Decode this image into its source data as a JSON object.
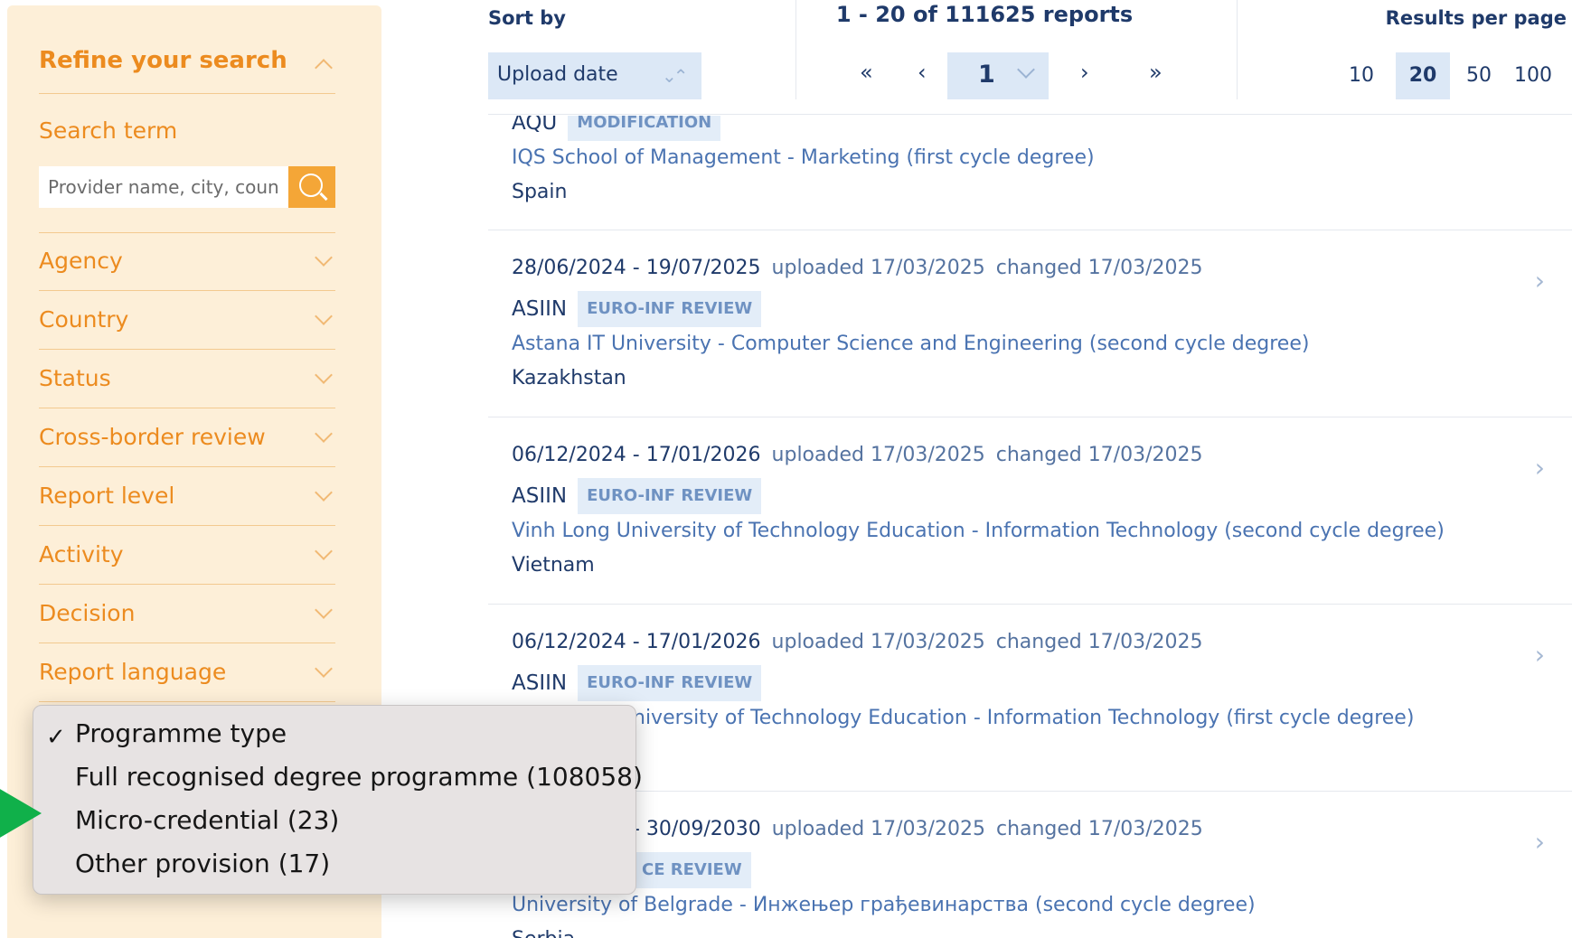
{
  "sidebar": {
    "title": "Refine your search",
    "search_label": "Search term",
    "search_placeholder": "Provider name, city, coun",
    "filters": [
      "Agency",
      "Country",
      "Status",
      "Cross-border review",
      "Report level",
      "Activity",
      "Decision",
      "Report language"
    ]
  },
  "toolbar": {
    "sort_label": "Sort by",
    "sort_value": "Upload date",
    "count_text": "1 - 20 of 111625 reports",
    "first": "«",
    "prev": "‹",
    "page": "1",
    "next": "›",
    "last": "»",
    "rpp_label": "Results per page",
    "rpp_options": [
      "10",
      "20",
      "50",
      "100"
    ],
    "rpp_selected": "20"
  },
  "results": [
    {
      "dates": "",
      "uploaded": "",
      "changed": "",
      "agency": "AQU",
      "badge": "MODIFICATION",
      "programme": "IQS School of Management - Marketing (first cycle degree)",
      "country": "Spain"
    },
    {
      "dates": "28/06/2024 - 19/07/2025",
      "uploaded": "uploaded 17/03/2025",
      "changed": "changed 17/03/2025",
      "agency": "ASIIN",
      "badge": "EURO-INF REVIEW",
      "programme": "Astana IT University - Computer Science and Engineering (second cycle degree)",
      "country": "Kazakhstan"
    },
    {
      "dates": "06/12/2024 - 17/01/2026",
      "uploaded": "uploaded 17/03/2025",
      "changed": "changed 17/03/2025",
      "agency": "ASIIN",
      "badge": "EURO-INF REVIEW",
      "programme": "Vinh Long University of Technology Education - Information Technology (second cycle degree)",
      "country": "Vietnam"
    },
    {
      "dates": "06/12/2024 - 17/01/2026",
      "uploaded": "uploaded 17/03/2025",
      "changed": "changed 17/03/2025",
      "agency": "ASIIN",
      "badge": "EURO-INF REVIEW",
      "programme": "niversity of Technology Education - Information Technology (first cycle degree)",
      "country": ""
    },
    {
      "dates": "- 30/09/2030",
      "uploaded": "uploaded 17/03/2025",
      "changed": "changed 17/03/2025",
      "agency": "",
      "badge": "CE REVIEW",
      "programme": "University of Belgrade - Инжењер грађевинарства (second cycle degree)",
      "country": "Serbia"
    }
  ],
  "popup": {
    "check": "✓",
    "options": [
      "Programme type",
      "Full recognised degree programme (108058)",
      "Micro-credential (23)",
      "Other provision (17)"
    ]
  },
  "colors": {
    "sidebar_bg": "#fdefd8",
    "accent_orange": "#ec8b1f",
    "navy": "#1f3a6a",
    "link_blue": "#4a73b1",
    "select_bg": "#dce8f6",
    "marker_green": "#10b04a"
  }
}
